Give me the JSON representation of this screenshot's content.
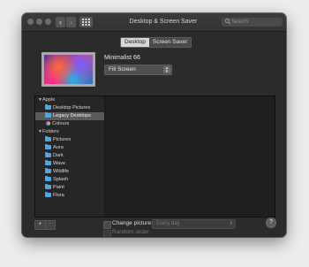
{
  "window": {
    "title": "Desktop & Screen Saver",
    "search_placeholder": "Search",
    "nav": {
      "back": "‹",
      "forward": "›"
    }
  },
  "tabs": [
    {
      "label": "Desktop",
      "active": true
    },
    {
      "label": "Screen Saver",
      "active": false
    }
  ],
  "wallpaper": {
    "name": "Minimalist 66",
    "fit": "Fill Screen"
  },
  "sidebar": {
    "groups": [
      {
        "label": "Apple",
        "items": [
          {
            "label": "Desktop Pictures",
            "icon": "folder-icon"
          },
          {
            "label": "Legacy Desktops",
            "icon": "folder-icon",
            "selected": true
          },
          {
            "label": "Colours",
            "icon": "color-wheel-icon"
          }
        ]
      },
      {
        "label": "Folders",
        "items": [
          {
            "label": "Pictures",
            "icon": "folder-icon"
          },
          {
            "label": "Aura",
            "icon": "folder-icon"
          },
          {
            "label": "Dark",
            "icon": "folder-icon"
          },
          {
            "label": "Wave",
            "icon": "folder-icon"
          },
          {
            "label": "Wildlife",
            "icon": "folder-icon"
          },
          {
            "label": "Splash",
            "icon": "folder-icon"
          },
          {
            "label": "Paint",
            "icon": "folder-icon"
          },
          {
            "label": "Flora",
            "icon": "folder-icon"
          }
        ]
      }
    ]
  },
  "footer": {
    "add": "+",
    "remove": "−",
    "change_picture_label": "Change picture:",
    "interval": "Every day",
    "random_order_label": "Random order",
    "help": "?"
  },
  "colors": {
    "window_bg": "#2b2b2b",
    "selection": "#5a5a5a",
    "folder_blue": "#4aa8e6"
  }
}
